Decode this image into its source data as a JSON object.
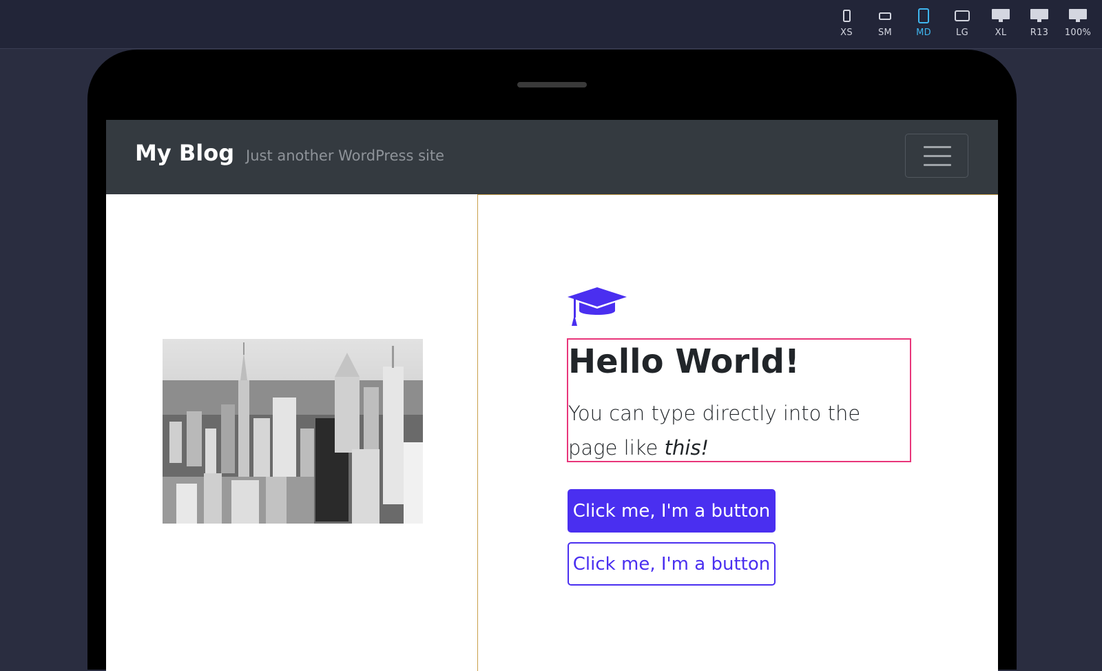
{
  "colors": {
    "accent": "#4a2ff0",
    "active_device": "#3fb6ef",
    "navbar_bg": "#343a40",
    "selection_outline": "#e8357a"
  },
  "devices": [
    {
      "label": "XS",
      "icon": "phone-portrait-icon"
    },
    {
      "label": "SM",
      "icon": "phone-landscape-icon"
    },
    {
      "label": "MD",
      "icon": "tablet-portrait-icon",
      "active": true
    },
    {
      "label": "LG",
      "icon": "tablet-landscape-icon"
    },
    {
      "label": "XL",
      "icon": "desktop-icon"
    },
    {
      "label": "R13",
      "icon": "desktop-icon"
    },
    {
      "label": "100%",
      "icon": "desktop-icon"
    }
  ],
  "site": {
    "brand": "My Blog",
    "tagline": "Just another WordPress site",
    "menu_icon": "hamburger-icon"
  },
  "hero": {
    "image": "city-skyline-photo",
    "icon": "graduation-cap-icon",
    "headline": "Hello World!",
    "lead_text": "You can type directly into the page like ",
    "lead_emphasis": "this!",
    "primary_button": "Click me, I'm a button",
    "outline_button": "Click me, I'm a button"
  }
}
